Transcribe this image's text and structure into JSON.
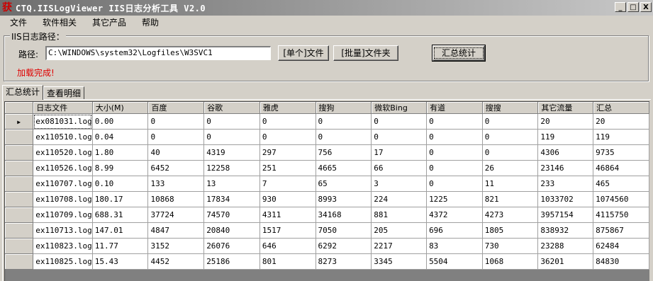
{
  "window": {
    "title": "CTQ.IISLogViewer IIS日志分析工具 V2.0",
    "icon_glyph": "获",
    "minimize": "_",
    "maximize": "□",
    "close": "X"
  },
  "menu": [
    "文件",
    "软件相关",
    "其它产品",
    "帮助"
  ],
  "group": {
    "legend": "IIS日志路径：",
    "path_label": "路径:",
    "path_value": "C:\\WINDOWS\\system32\\Logfiles\\W3SVC1",
    "btn_single": "[单个]文件",
    "btn_batch": "[批量]文件夹",
    "btn_summary": "汇总统计",
    "status": "加载完成!"
  },
  "tabs": [
    "汇总统计",
    "查看明细"
  ],
  "table": {
    "columns": [
      "日志文件",
      "大小(M)",
      "百度",
      "谷歌",
      "雅虎",
      "搜狗",
      "微软Bing",
      "有道",
      "搜搜",
      "其它流量",
      "汇总"
    ],
    "current_row_marker": "▶",
    "rows": [
      [
        "ex081031.log",
        "0.00",
        "0",
        "0",
        "0",
        "0",
        "0",
        "0",
        "0",
        "20",
        "20"
      ],
      [
        "ex110510.log",
        "0.04",
        "0",
        "0",
        "0",
        "0",
        "0",
        "0",
        "0",
        "119",
        "119"
      ],
      [
        "ex110520.log",
        "1.80",
        "40",
        "4319",
        "297",
        "756",
        "17",
        "0",
        "0",
        "4306",
        "9735"
      ],
      [
        "ex110526.log",
        "8.99",
        "6452",
        "12258",
        "251",
        "4665",
        "66",
        "0",
        "26",
        "23146",
        "46864"
      ],
      [
        "ex110707.log",
        "0.10",
        "133",
        "13",
        "7",
        "65",
        "3",
        "0",
        "11",
        "233",
        "465"
      ],
      [
        "ex110708.log",
        "180.17",
        "10868",
        "17834",
        "930",
        "8993",
        "224",
        "1225",
        "821",
        "1033702",
        "1074560"
      ],
      [
        "ex110709.log",
        "688.31",
        "37724",
        "74570",
        "4311",
        "34168",
        "881",
        "4372",
        "4273",
        "3957154",
        "4115750"
      ],
      [
        "ex110713.log",
        "147.01",
        "4847",
        "20840",
        "1517",
        "7050",
        "205",
        "696",
        "1805",
        "838932",
        "875867"
      ],
      [
        "ex110823.log",
        "11.77",
        "3152",
        "26076",
        "646",
        "6292",
        "2217",
        "83",
        "730",
        "23288",
        "62484"
      ],
      [
        "ex110825.log",
        "15.43",
        "4452",
        "25186",
        "801",
        "8273",
        "3345",
        "5504",
        "1068",
        "36201",
        "84830"
      ]
    ]
  }
}
